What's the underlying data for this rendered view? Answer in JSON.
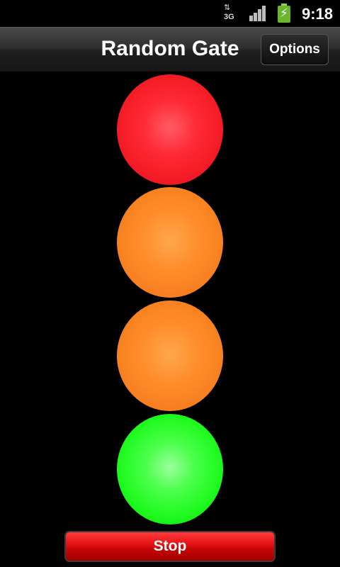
{
  "status_bar": {
    "network_type": "3G",
    "network_arrows": "⇅",
    "signal_icon": "signal-bars-icon",
    "battery_icon": "battery-charging-icon",
    "time": "9:18"
  },
  "title_bar": {
    "title": "Random Gate",
    "options_label": "Options"
  },
  "lights": [
    {
      "name": "red",
      "color": "#ff2a35"
    },
    {
      "name": "orange",
      "color": "#ff8c29"
    },
    {
      "name": "orange",
      "color": "#ff8c29"
    },
    {
      "name": "green",
      "color": "#1dfa1d"
    }
  ],
  "stop_button": {
    "label": "Stop",
    "color": "#e21111"
  }
}
